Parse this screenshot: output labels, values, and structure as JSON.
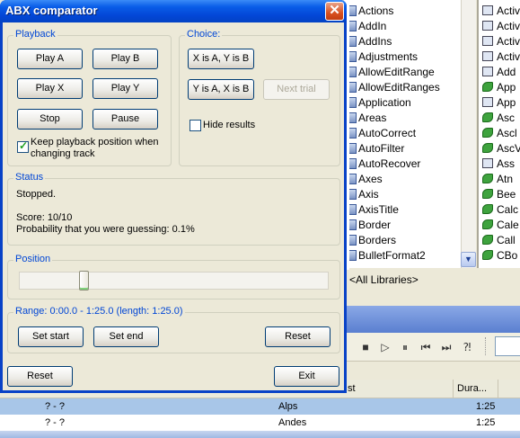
{
  "background": {
    "members": [
      "Actions",
      "AddIn",
      "AddIns",
      "Adjustments",
      "AllowEditRange",
      "AllowEditRanges",
      "Application",
      "Areas",
      "AutoCorrect",
      "AutoFilter",
      "AutoRecover",
      "Axes",
      "Axis",
      "AxisTitle",
      "Border",
      "Borders",
      "BulletFormat2"
    ],
    "classes": [
      {
        "icon": "class",
        "text": "Activ"
      },
      {
        "icon": "class",
        "text": "Activ"
      },
      {
        "icon": "class",
        "text": "Activ"
      },
      {
        "icon": "class",
        "text": "Activ"
      },
      {
        "icon": "class",
        "text": "Add"
      },
      {
        "icon": "member",
        "text": "App"
      },
      {
        "icon": "class",
        "text": "App"
      },
      {
        "icon": "member",
        "text": "Asc"
      },
      {
        "icon": "member",
        "text": "Ascl"
      },
      {
        "icon": "member",
        "text": "AscV"
      },
      {
        "icon": "class",
        "text": "Ass"
      },
      {
        "icon": "member",
        "text": "Atn"
      },
      {
        "icon": "member",
        "text": "Bee"
      },
      {
        "icon": "member",
        "text": "Calc"
      },
      {
        "icon": "member",
        "text": "Cale"
      },
      {
        "icon": "member",
        "text": "Call"
      },
      {
        "icon": "member",
        "text": "CBo"
      }
    ],
    "library_label": "<All Libraries>",
    "columns": [
      "st",
      "Dura..."
    ],
    "rows": [
      {
        "artist": "? - ?",
        "title": "Alps",
        "duration": "1:25"
      },
      {
        "artist": "? - ?",
        "title": "Andes",
        "duration": "1:25"
      }
    ]
  },
  "dialog": {
    "title": "ABX comparator",
    "playback": {
      "legend": "Playback",
      "play_a": "Play A",
      "play_b": "Play B",
      "play_x": "Play X",
      "play_y": "Play Y",
      "stop": "Stop",
      "pause": "Pause",
      "keep_position_label": "Keep playback position when changing track",
      "keep_position_checked": true
    },
    "choice": {
      "legend": "Choice:",
      "x_is_a": "X is A, Y is B",
      "y_is_a": "Y is A, X is B",
      "next_trial": "Next trial",
      "hide_results_label": "Hide results",
      "hide_results_checked": false
    },
    "status": {
      "legend": "Status",
      "state": "Stopped.",
      "score": "Score: 10/10",
      "probability": "Probability that you were guessing: 0.1%"
    },
    "position": {
      "legend": "Position",
      "value": 0.2
    },
    "range": {
      "legend": "Range: 0:00.0 - 1:25.0 (length: 1:25.0)",
      "set_start": "Set start",
      "set_end": "Set end",
      "reset": "Reset"
    },
    "footer": {
      "reset": "Reset",
      "exit": "Exit"
    }
  }
}
